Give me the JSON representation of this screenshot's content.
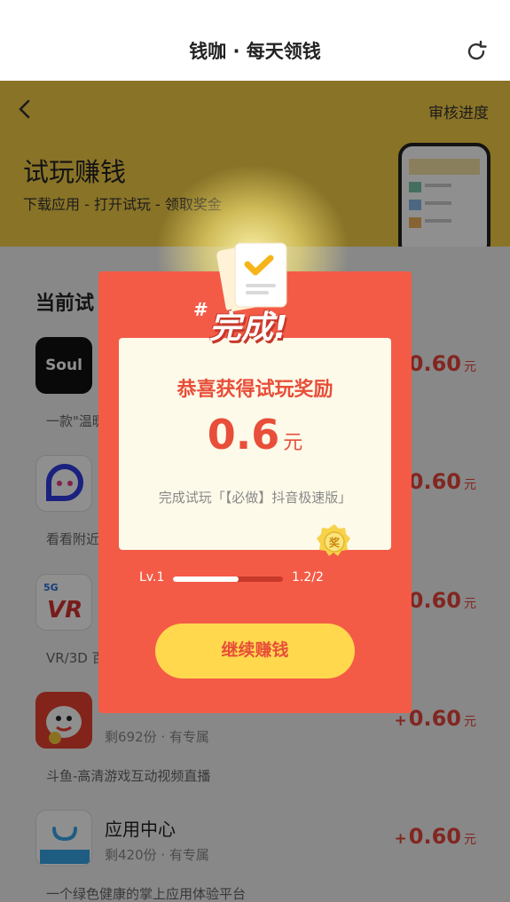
{
  "topbar": {
    "title": "钱咖 · 每天领钱",
    "refresh_icon": "refresh-icon"
  },
  "hero": {
    "back_icon": "chevron-left-icon",
    "audit_label": "审核进度",
    "title": "试玩赚钱",
    "subtitle": "下载应用 - 打开试玩 - 领取奖金"
  },
  "list": {
    "section_title": "当前试",
    "apps": [
      {
        "icon": "soul-app-icon",
        "name": "",
        "meta": "",
        "desc": "一款\"温暖",
        "reward_value": "0.60",
        "reward_unit": "元"
      },
      {
        "icon": "chat-bubble-app-icon",
        "name": "",
        "meta": "",
        "desc": "看看附近",
        "reward_value": "0.60",
        "reward_unit": "元"
      },
      {
        "icon": "vr-app-icon",
        "name": "",
        "meta": "",
        "desc": "VR/3D 百",
        "reward_value": "0.60",
        "reward_unit": "元"
      },
      {
        "icon": "douyu-app-icon",
        "name": "",
        "meta": "剩692份 · 有专属",
        "desc": "斗鱼-高清游戏互动视频直播",
        "reward_value": "0.60",
        "reward_unit": "元"
      },
      {
        "icon": "app-center-icon",
        "name": "应用中心",
        "meta": "剩420份 · 有专属",
        "desc": "一个绿色健康的掌上应用体验平台",
        "reward_value": "0.60",
        "reward_unit": "元"
      }
    ],
    "plus": "+"
  },
  "modal": {
    "done_hash": "#",
    "done_text": "完成!",
    "congrats": "恭喜获得试玩奖励",
    "amount": "0.6",
    "amount_unit": "元",
    "desc": "完成试玩「【必做】抖音极速版」",
    "badge_char": "奖",
    "level_label": "Lv.1",
    "progress": 0.6,
    "progress_count": "1.2/2",
    "cta_label": "继续赚钱"
  },
  "colors": {
    "brand_yellow": "#f5cd47",
    "modal_red": "#f45b46",
    "reward_red": "#e8443b",
    "cta_yellow": "#ffd84e"
  }
}
